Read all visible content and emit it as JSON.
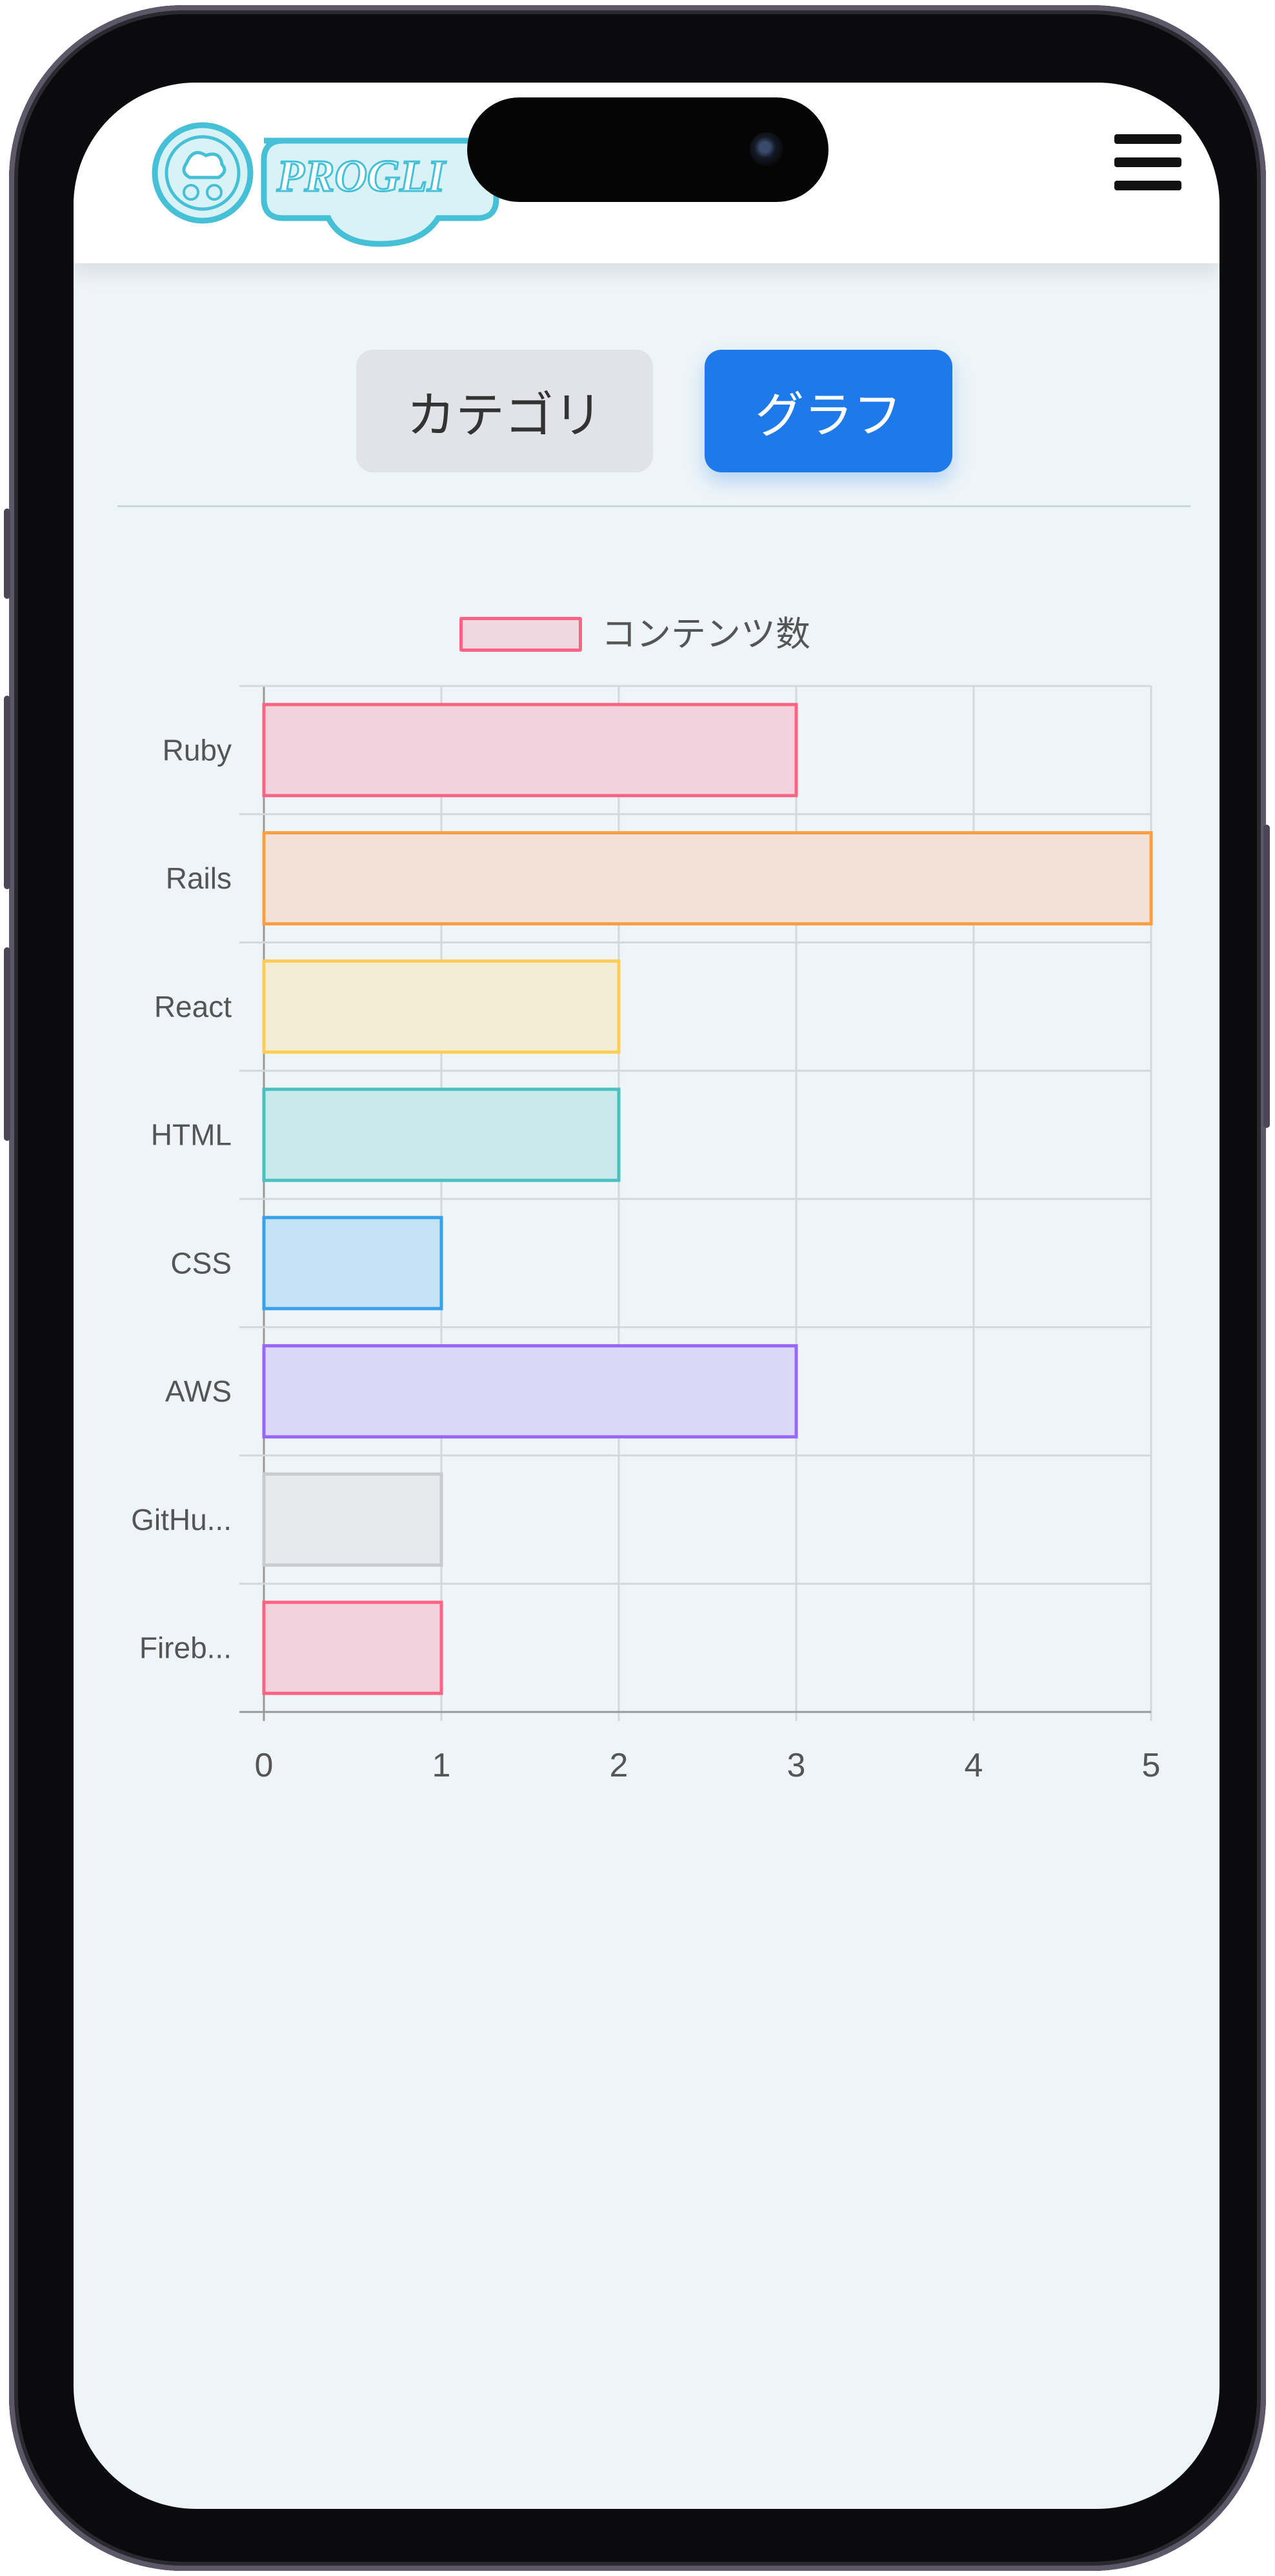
{
  "app": {
    "logo_text": "PROGLI"
  },
  "tabs": [
    {
      "label": "カテゴリ",
      "active": false
    },
    {
      "label": "グラフ",
      "active": true
    }
  ],
  "colors": {
    "accent": "#1f7ae9",
    "inactive_tab": "#e1e3e8"
  },
  "icons": {
    "menu": "hamburger-menu-icon",
    "logo": "logo-icon"
  },
  "chart_data": {
    "type": "bar",
    "orientation": "horizontal",
    "categories": [
      "Ruby",
      "Rails",
      "React",
      "HTML",
      "CSS",
      "AWS",
      "GitHu...",
      "Fireb..."
    ],
    "series": [
      {
        "name": "コンテンツ数",
        "values": [
          3,
          5,
          2,
          2,
          1,
          3,
          1,
          1
        ],
        "border_colors": [
          "#ff6384",
          "#ff9f40",
          "#ffcd56",
          "#4bc0c0",
          "#36a2eb",
          "#9966ff",
          "#c9cbcf",
          "#ff6384"
        ],
        "fill_colors": [
          "#f2d3dd",
          "#f2e1d7",
          "#f4edd6",
          "#c8eaeb",
          "#c3e2f3",
          "#dbd7f7",
          "#e6eaeb",
          "#f2d3dd"
        ]
      }
    ],
    "xlim": [
      0,
      5
    ],
    "xticks": [
      "0",
      "1",
      "2",
      "3",
      "4",
      "5"
    ],
    "grid": true,
    "legend_position": "top"
  }
}
